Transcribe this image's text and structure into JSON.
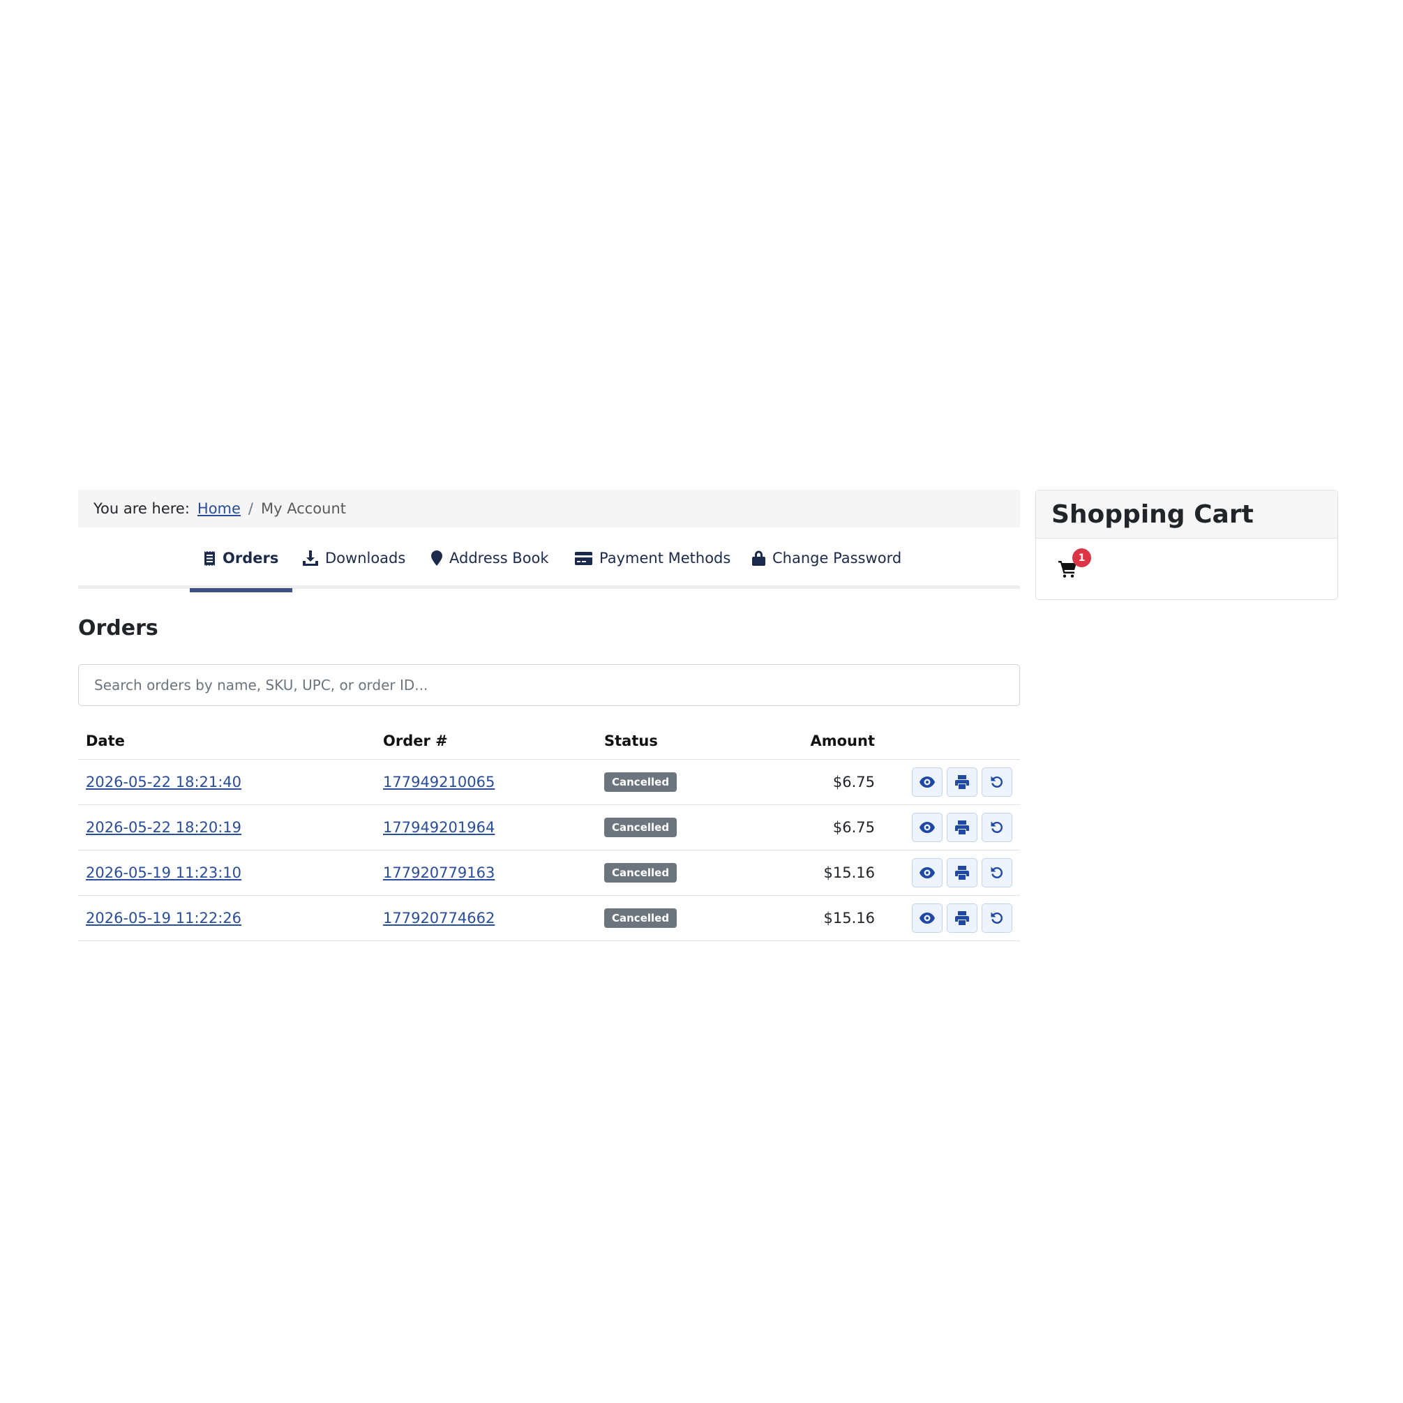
{
  "breadcrumb": {
    "prefix": "You are here:",
    "home": "Home",
    "separator": "/",
    "current": "My Account"
  },
  "tabs": [
    {
      "label": "Orders",
      "icon": "receipt-icon",
      "active": true
    },
    {
      "label": "Downloads",
      "icon": "download-icon",
      "active": false
    },
    {
      "label": "Address Book",
      "icon": "map-marker-icon",
      "active": false
    },
    {
      "label": "Payment Methods",
      "icon": "credit-card-icon",
      "active": false
    },
    {
      "label": "Change Password",
      "icon": "lock-icon",
      "active": false
    }
  ],
  "orders": {
    "title": "Orders",
    "search_placeholder": "Search orders by name, SKU, UPC, or order ID...",
    "columns": {
      "date": "Date",
      "order": "Order #",
      "status": "Status",
      "amount": "Amount"
    },
    "rows": [
      {
        "date": "2026-05-22 18:21:40",
        "order": "177949210065",
        "status": "Cancelled",
        "amount": "$6.75"
      },
      {
        "date": "2026-05-22 18:20:19",
        "order": "177949201964",
        "status": "Cancelled",
        "amount": "$6.75"
      },
      {
        "date": "2026-05-19 11:23:10",
        "order": "177920779163",
        "status": "Cancelled",
        "amount": "$15.16"
      },
      {
        "date": "2026-05-19 11:22:26",
        "order": "177920774662",
        "status": "Cancelled",
        "amount": "$15.16"
      }
    ],
    "row_actions": [
      "eye-icon",
      "print-icon",
      "reorder-icon"
    ]
  },
  "cart": {
    "title": "Shopping Cart",
    "count": "1",
    "icon": "shopping-cart-icon"
  },
  "colors": {
    "link": "#2a4d9b",
    "tab_active_underline": "#3e5184",
    "badge_cancelled": "#6c757d",
    "cart_count_badge": "#dc3545",
    "action_icon": "#1f48a6"
  }
}
